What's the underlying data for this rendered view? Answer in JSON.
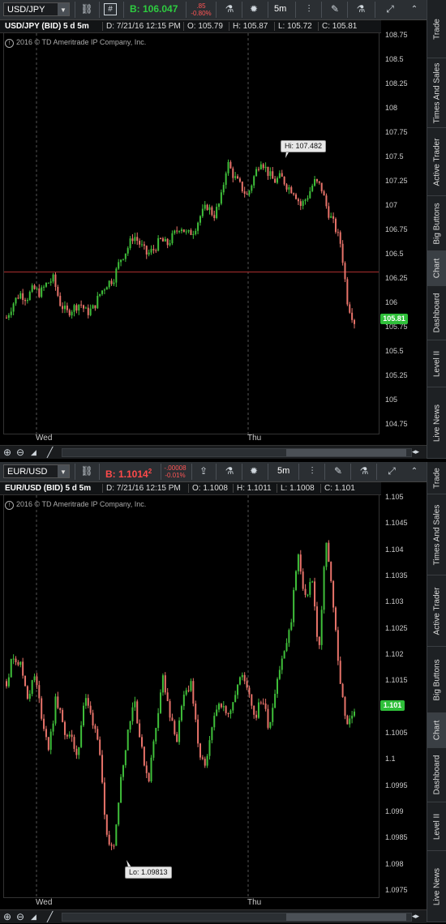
{
  "panels": [
    {
      "symbol": "USD/JPY",
      "bid": "B: 106.047",
      "bid_color": "#2ecc40",
      "change_abs": ".85",
      "change_pct": "-0.80%",
      "timeframe": "5m",
      "title": "USD/JPY (BID) 5 d 5m",
      "date": "D: 7/21/16 12:15 PM",
      "open": "O: 105.79",
      "high": "H: 105.87",
      "low": "L: 105.72",
      "close": "C: 105.81",
      "copyright": "2016 © TD Ameritrade IP Company, Inc.",
      "price_tag": "105.81",
      "callout": "Hi: 107.482",
      "x_labels": [
        "Wed",
        "Thu"
      ],
      "y_ticks": [
        "108.75",
        "108.5",
        "108.25",
        "108",
        "107.75",
        "107.5",
        "107.25",
        "107",
        "106.75",
        "106.5",
        "106.25",
        "106",
        "105.75",
        "105.5",
        "105.25",
        "105",
        "104.75"
      ],
      "tabs": [
        "Trade",
        "Times And Sales",
        "Active Trader",
        "Big Buttons",
        "Chart",
        "Dashboard",
        "Level II",
        "Live News"
      ],
      "chart_data": {
        "type": "candlestick",
        "title": "USD/JPY (BID) 5 d 5m",
        "ylim": [
          104.75,
          108.75
        ],
        "x": [
          "Wed",
          "Thu"
        ],
        "path": [
          105.85,
          106.0,
          106.1,
          106.05,
          106.15,
          106.1,
          106.2,
          106.25,
          106.0,
          105.9,
          105.95,
          106.0,
          105.9,
          105.95,
          106.1,
          106.2,
          106.25,
          106.45,
          106.55,
          106.7,
          106.6,
          106.5,
          106.55,
          106.65,
          106.6,
          106.7,
          106.8,
          106.7,
          106.75,
          106.9,
          107.0,
          106.9,
          107.05,
          107.45,
          107.3,
          107.2,
          107.1,
          107.3,
          107.482,
          107.35,
          107.25,
          107.3,
          107.2,
          107.15,
          107.0,
          107.1,
          107.25,
          107.2,
          106.95,
          106.8,
          106.6,
          106.0,
          105.81
        ],
        "reference_line": 106.32,
        "high_label": "Hi: 107.482"
      }
    },
    {
      "symbol": "EUR/USD",
      "bid": "B: 1.1014",
      "bid_sup": "2",
      "bid_color": "#ff4a4a",
      "change_abs": "-.00008",
      "change_pct": "-0.01%",
      "timeframe": "5m",
      "title": "EUR/USD (BID) 5 d 5m",
      "date": "D: 7/21/16 12:15 PM",
      "open": "O: 1.1008",
      "high": "H: 1.1011",
      "low": "L: 1.1008",
      "close": "C: 1.101",
      "copyright": "2016 © TD Ameritrade IP Company, Inc.",
      "price_tag": "1.101",
      "callout": "Lo: 1.09813",
      "x_labels": [
        "Wed",
        "Thu"
      ],
      "y_ticks": [
        "1.105",
        "1.1045",
        "1.104",
        "1.1035",
        "1.103",
        "1.1025",
        "1.102",
        "1.1015",
        "1.101",
        "1.1005",
        "1.1",
        "1.0995",
        "1.099",
        "1.0985",
        "1.098",
        "1.0975"
      ],
      "tabs": [
        "Trade",
        "Times And Sales",
        "Active Trader",
        "Big Buttons",
        "Chart",
        "Dashboard",
        "Level II",
        "Live News"
      ],
      "chart_data": {
        "type": "candlestick",
        "title": "EUR/USD (BID) 5 d 5m",
        "ylim": [
          1.0975,
          1.1055
        ],
        "x": [
          "Wed",
          "Thu"
        ],
        "path": [
          1.1015,
          1.102,
          1.1018,
          1.1012,
          1.1016,
          1.1008,
          1.1002,
          1.1012,
          1.1006,
          1.1004,
          1.1001,
          1.1012,
          1.1008,
          1.1004,
          1.0985,
          1.0983,
          1.0995,
          1.1005,
          1.1012,
          1.1002,
          1.0996,
          1.1006,
          1.1016,
          1.1008,
          1.1004,
          1.1012,
          1.1015,
          1.1002,
          1.0998,
          1.1006,
          1.1012,
          1.1008,
          1.1012,
          1.1016,
          1.1014,
          1.1008,
          1.1012,
          1.1006,
          1.1015,
          1.102,
          1.1025,
          1.104,
          1.103,
          1.1035,
          1.102,
          1.1042,
          1.103,
          1.1015,
          1.1006,
          1.101
        ],
        "low_label": "Lo: 1.09813"
      }
    }
  ]
}
